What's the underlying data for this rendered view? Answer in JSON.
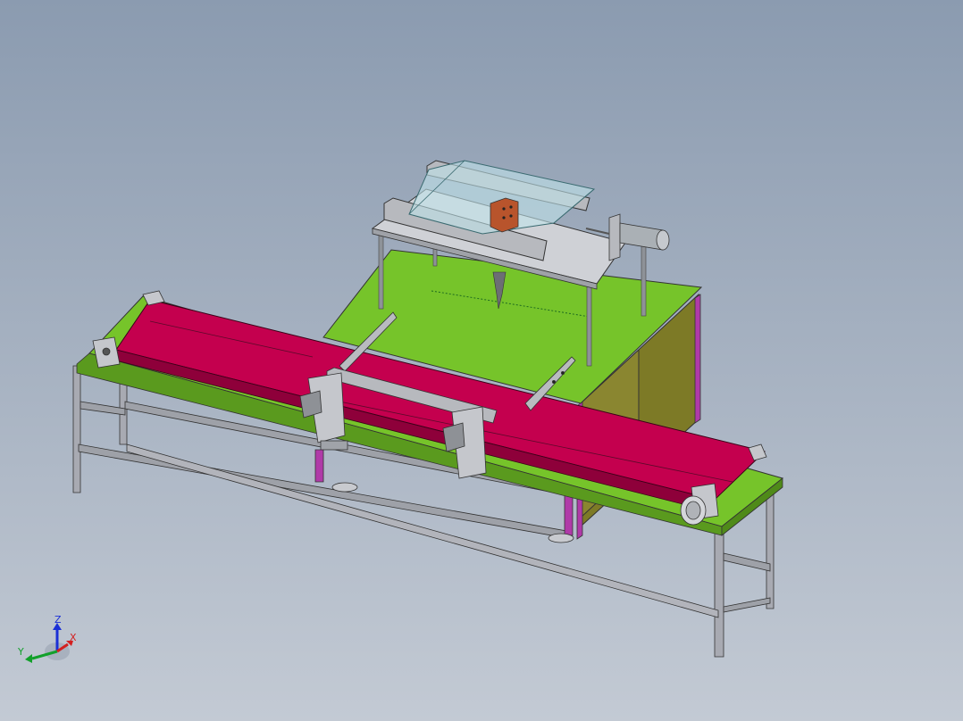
{
  "triad": {
    "z_label": "Z",
    "y_label": "Y",
    "x_label": "X",
    "colors": {
      "z": "#1a2fd6",
      "y": "#12a02a",
      "x": "#d32020"
    }
  },
  "colors": {
    "belt": "#c4004e",
    "belt_shade": "#8e003a",
    "table_top": "#76c42a",
    "table_side": "#5a9a1e",
    "cabinet_side": "#7a7a22",
    "frame": "#a8aab2",
    "frame_dark": "#6d7079",
    "magenta_post": "#b03aa8",
    "glass": "#bfe3ea",
    "block": "#b8542c",
    "plate": "#c9cbd0"
  }
}
